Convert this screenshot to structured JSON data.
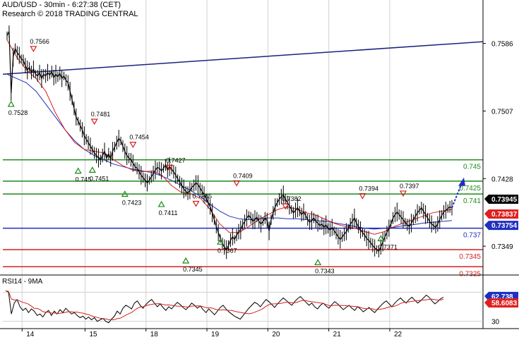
{
  "header": {
    "title": "AUD/USD - 30min - 6:27:38 (CET)",
    "subtitle": "Research © 2018 TRADING CENTRAL"
  },
  "rsi_panel": {
    "title": "RSI14 - 9MA"
  },
  "chart_data": {
    "type": "line",
    "instrument": "AUD/USD",
    "timeframe": "30min",
    "x_tick_labels": [
      "14",
      "15",
      "18",
      "19",
      "20",
      "21",
      "22"
    ],
    "price_axis": {
      "ylim": [
        0.7317,
        0.7612
      ],
      "tick_labels": [
        "0.7586",
        "0.7507",
        "0.7428",
        "0.7349"
      ]
    },
    "price_series": [
      [
        0.7595,
        0.76,
        0.7528,
        0.757,
        0.758,
        0.7575,
        0.7572,
        0.7568,
        0.7566,
        0.756,
        0.7555,
        0.7558,
        0.7552,
        0.7556,
        0.755,
        0.7548,
        0.7552,
        0.7545,
        0.755,
        0.7548,
        0.7552,
        0.7549,
        0.7553,
        0.7546,
        0.755,
        0.7547,
        0.7551,
        0.7545,
        0.7548,
        0.7543
      ],
      [
        0.754,
        0.753,
        0.752,
        0.751,
        0.75,
        0.7495,
        0.749,
        0.7485,
        0.7478,
        0.7474,
        0.747,
        0.7466,
        0.7462,
        0.7458,
        0.7455,
        0.7452,
        0.745,
        0.7455,
        0.746,
        0.7452,
        0.7457,
        0.7451,
        0.746,
        0.7465,
        0.747,
        0.7475,
        0.7472,
        0.7466,
        0.746,
        0.7455
      ],
      [
        0.7452,
        0.745,
        0.7446,
        0.7442,
        0.744,
        0.7436,
        0.7432,
        0.7429,
        0.7426,
        0.7423,
        0.7426,
        0.743,
        0.7434,
        0.7438,
        0.7441,
        0.744,
        0.7437,
        0.744,
        0.7444,
        0.7438,
        0.7442,
        0.7439,
        0.7436,
        0.7432,
        0.7428,
        0.7424,
        0.742,
        0.7416,
        0.7413,
        0.7411
      ],
      [
        0.7414,
        0.7418,
        0.742,
        0.7423,
        0.7421,
        0.7417,
        0.7413,
        0.7409,
        0.7405,
        0.74,
        0.7395,
        0.7388,
        0.738,
        0.7372,
        0.7365,
        0.7358,
        0.7352,
        0.7348,
        0.7345,
        0.735,
        0.7356,
        0.736,
        0.7357,
        0.7362,
        0.7366,
        0.7368,
        0.7374,
        0.7378,
        0.7382,
        0.7385
      ],
      [
        0.7382,
        0.7378,
        0.738,
        0.7383,
        0.7378,
        0.7375,
        0.7378,
        0.7382,
        0.7379,
        0.7367,
        0.738,
        0.7388,
        0.7395,
        0.74,
        0.7404,
        0.7407,
        0.7409,
        0.7404,
        0.74,
        0.7396,
        0.7392,
        0.7388,
        0.7391,
        0.7394,
        0.739,
        0.7386,
        0.7389,
        0.7385,
        0.738,
        0.7377
      ],
      [
        0.7379,
        0.7382,
        0.7378,
        0.7376,
        0.7373,
        0.7375,
        0.7371,
        0.7374,
        0.737,
        0.7368,
        0.7371,
        0.7367,
        0.7364,
        0.736,
        0.7357,
        0.736,
        0.7363,
        0.7366,
        0.737,
        0.7375,
        0.7378,
        0.7382,
        0.7376,
        0.7372,
        0.7368,
        0.7365,
        0.7362,
        0.7358,
        0.7356,
        0.7353
      ],
      [
        0.735,
        0.7347,
        0.7345,
        0.7343,
        0.7348,
        0.7354,
        0.736,
        0.7365,
        0.737,
        0.7375,
        0.7382,
        0.7386,
        0.7389,
        0.7386,
        0.7383,
        0.738,
        0.7377,
        0.7374,
        0.7372,
        0.7376,
        0.738,
        0.7384,
        0.7388,
        0.7391,
        0.7394,
        0.739,
        0.7386,
        0.7382,
        0.7378,
        0.7375
      ],
      [
        0.7373,
        0.7371,
        0.7375,
        0.738,
        0.7385,
        0.7389,
        0.7391,
        0.7393,
        0.7395,
        0.7394
      ]
    ],
    "ma_fast": [
      0.759,
      0.757,
      0.7555,
      0.7545,
      0.753,
      0.7505,
      0.7485,
      0.747,
      0.7462,
      0.746,
      0.7458,
      0.745,
      0.7443,
      0.7438,
      0.7436,
      0.7437,
      0.7432,
      0.742,
      0.7412,
      0.741,
      0.7405,
      0.7392,
      0.7375,
      0.7365,
      0.7365,
      0.7372,
      0.738,
      0.7386,
      0.7392,
      0.7395,
      0.7392,
      0.7388,
      0.7385,
      0.738,
      0.7375,
      0.7372,
      0.737,
      0.7366,
      0.7363,
      0.7366,
      0.7372,
      0.7376,
      0.738,
      0.7384,
      0.7388,
      0.739,
      0.7392
    ],
    "ma_slow": [
      0.755,
      0.7545,
      0.754,
      0.753,
      0.7515,
      0.75,
      0.7485,
      0.7472,
      0.7462,
      0.7455,
      0.745,
      0.7445,
      0.7442,
      0.7439,
      0.7437,
      0.7435,
      0.7431,
      0.7426,
      0.742,
      0.7414,
      0.7407,
      0.7398,
      0.739,
      0.7384,
      0.7381,
      0.738,
      0.7381,
      0.7382,
      0.7382,
      0.7381,
      0.7381,
      0.738,
      0.7379,
      0.7378,
      0.7376,
      0.7374,
      0.7372,
      0.737,
      0.7369,
      0.737,
      0.7371,
      0.7373,
      0.7374,
      0.7376,
      0.7377,
      0.7378,
      0.7379
    ],
    "trend_line": [
      0.755,
      0.7588
    ],
    "projection": [
      0.7394,
      0.7426
    ],
    "horizontal_levels": [
      {
        "value": 0.745,
        "label": "0.745",
        "color": "#1a8a1a"
      },
      {
        "value": 0.7425,
        "label": "0.7425",
        "color": "#1a8a1a"
      },
      {
        "value": 0.741,
        "label": "0.741",
        "color": "#1a8a1a"
      },
      {
        "value": 0.737,
        "label": "0.737",
        "color": "#1f2fbf"
      },
      {
        "value": 0.7345,
        "label": "0.7345",
        "color": "#d42020"
      },
      {
        "value": 0.7325,
        "label": "0.7325",
        "color": "#d42020"
      }
    ],
    "price_tags": [
      {
        "label": "0.73945",
        "bg": "#000000",
        "fg": "#ffffff",
        "value": 0.73945
      },
      {
        "label": "0.73837",
        "bg": "#e02020",
        "fg": "#ffffff",
        "value": 0.73837
      },
      {
        "label": "0.73754",
        "bg": "#1f2fbf",
        "fg": "#ffffff",
        "value": 0.73754
      }
    ],
    "swing_points": [
      {
        "label": "0.7528",
        "value": 0.7528,
        "kind": "low"
      },
      {
        "label": "0.7566",
        "value": 0.7566,
        "kind": "high"
      },
      {
        "label": "0.7481",
        "value": 0.7481,
        "kind": "high"
      },
      {
        "label": "0.745",
        "value": 0.745,
        "kind": "low"
      },
      {
        "label": "0.7451",
        "value": 0.7451,
        "kind": "low"
      },
      {
        "label": "0.7454",
        "value": 0.7454,
        "kind": "high"
      },
      {
        "label": "0.7423",
        "value": 0.7423,
        "kind": "low"
      },
      {
        "label": "0.7427",
        "value": 0.7427,
        "kind": "high"
      },
      {
        "label": "0.7411",
        "value": 0.7411,
        "kind": "low"
      },
      {
        "label": "0.7385",
        "value": 0.7385,
        "kind": "high"
      },
      {
        "label": "0.7345",
        "value": 0.7345,
        "kind": "low"
      },
      {
        "label": "0.7409",
        "value": 0.7409,
        "kind": "high"
      },
      {
        "label": "0.7367",
        "value": 0.7367,
        "kind": "low"
      },
      {
        "label": "0.7382",
        "value": 0.7382,
        "kind": "high"
      },
      {
        "label": "0.7343",
        "value": 0.7343,
        "kind": "low"
      },
      {
        "label": "0.7394",
        "value": 0.7394,
        "kind": "high"
      },
      {
        "label": "0.7371",
        "value": 0.7371,
        "kind": "low"
      },
      {
        "label": "0.7397",
        "value": 0.7397,
        "kind": "high"
      }
    ],
    "rsi": {
      "ylim": [
        20,
        80
      ],
      "tick_labels": [
        "30"
      ],
      "ma_tag": {
        "label": "58.6083",
        "bg": "#e02020",
        "fg": "#ffffff",
        "value": 58.6083
      },
      "rsi_tag": {
        "label": "62.738",
        "bg": "#1f2fbf",
        "fg": "#ffffff",
        "value": 62.738
      },
      "rsi_series": [
        72,
        70,
        40,
        55,
        60,
        50,
        45,
        48,
        42,
        47,
        44,
        38,
        40,
        36,
        42,
        45,
        38,
        44,
        40,
        46,
        42,
        48,
        44,
        40,
        42,
        38,
        35,
        37,
        33,
        36,
        32,
        35,
        30,
        32,
        34,
        30,
        28,
        33,
        37,
        44,
        40,
        48,
        52,
        50,
        47,
        55,
        58,
        52,
        48,
        53,
        57,
        60,
        55,
        50,
        54,
        49,
        45,
        50,
        47,
        52,
        56,
        53,
        49,
        46,
        50,
        55,
        52,
        48,
        51,
        46,
        42,
        47,
        43,
        39,
        44,
        49,
        52,
        47,
        43,
        40,
        37,
        35,
        33,
        38,
        43,
        48,
        52,
        56,
        54,
        50,
        55,
        60,
        57,
        53,
        49,
        54,
        58,
        62,
        59,
        55,
        52,
        57,
        61,
        64,
        60,
        56,
        52,
        55,
        50,
        47,
        52,
        55,
        51,
        48,
        53,
        57,
        54,
        50,
        46,
        49,
        52,
        48,
        45,
        50,
        47,
        43,
        46,
        49,
        45,
        42,
        47,
        51,
        55,
        58,
        54,
        50,
        55,
        59,
        62,
        58,
        55,
        60,
        63,
        59,
        55,
        58,
        62,
        66,
        63,
        58,
        54,
        57,
        61,
        63
      ]
    },
    "colors": {
      "price": "#000000",
      "ma_fast": "#d42020",
      "ma_slow": "#1f2fbf",
      "trend_line": "#1a237e",
      "projection": "#1f2fbf",
      "high_marker": "#d42020",
      "low_marker": "#1a8a1a"
    }
  }
}
